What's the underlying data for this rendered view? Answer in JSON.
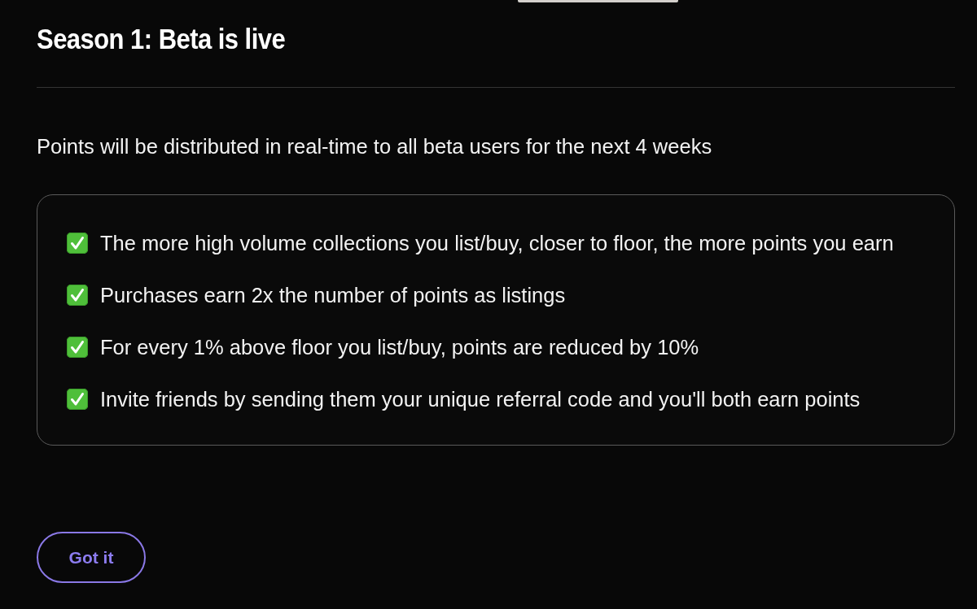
{
  "dialog": {
    "title": "Season 1: Beta is live",
    "description": "Points will be distributed in real-time to all beta users for the next 4 weeks",
    "rules": [
      "The more high volume collections you list/buy, closer to floor, the more points you earn",
      "Purchases earn 2x the number of points as listings",
      "For every 1% above floor you list/buy, points are reduced by 10%",
      "Invite friends by sending them your unique referral code and you'll both earn points"
    ],
    "buttons": [
      {
        "label": "Got it"
      }
    ]
  }
}
